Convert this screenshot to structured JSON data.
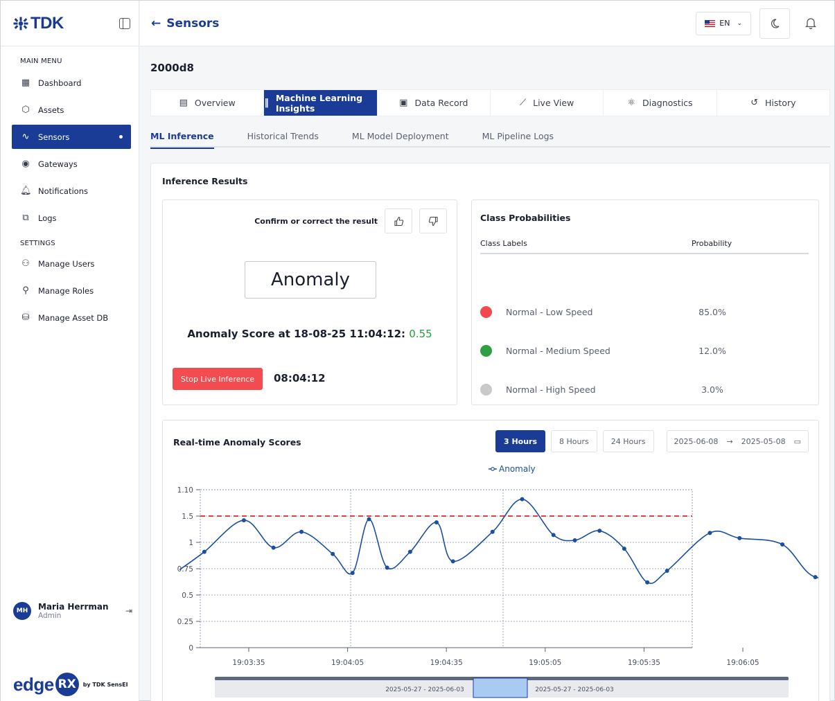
{
  "sidebar": {
    "brand": "TDK",
    "main_menu_heading": "MAIN MENU",
    "settings_heading": "SETTINGS",
    "main_items": [
      {
        "label": "Dashboard",
        "icon": "grid-icon"
      },
      {
        "label": "Assets",
        "icon": "cube-icon"
      },
      {
        "label": "Sensors",
        "icon": "pulse-icon",
        "active": true
      },
      {
        "label": "Gateways",
        "icon": "broadcast-icon"
      },
      {
        "label": "Notifications",
        "icon": "bell-icon"
      },
      {
        "label": "Logs",
        "icon": "copy-icon"
      }
    ],
    "settings_items": [
      {
        "label": "Manage Users",
        "icon": "users-icon"
      },
      {
        "label": "Manage Roles",
        "icon": "user-role-icon"
      },
      {
        "label": "Manage Asset DB",
        "icon": "database-icon"
      }
    ],
    "user": {
      "initials": "MH",
      "name": "Maria Herrman",
      "role": "Admin"
    },
    "footer": {
      "edge": "edge",
      "rx": "RX",
      "by": "by TDK SensEI"
    }
  },
  "header": {
    "back_label": "Sensors",
    "language": "EN"
  },
  "device": {
    "id": "2000d8"
  },
  "tabs": [
    {
      "label": "Overview",
      "icon": "document-icon"
    },
    {
      "label": "Machine Learning Insights",
      "icon": "bars-icon",
      "active": true
    },
    {
      "label": "Data Record",
      "icon": "file-check-icon"
    },
    {
      "label": "Live View",
      "icon": "chart-line-icon"
    },
    {
      "label": "Diagnostics",
      "icon": "atom-icon"
    },
    {
      "label": "History",
      "icon": "history-icon"
    }
  ],
  "subtabs": [
    {
      "label": "ML Inference",
      "active": true
    },
    {
      "label": "Historical Trends"
    },
    {
      "label": "ML Model Deployment"
    },
    {
      "label": "ML Pipeline Logs"
    }
  ],
  "inference": {
    "panel_title": "Inference Results",
    "confirm_label": "Confirm or correct the result",
    "result": "Anomaly",
    "score_prefix": "Anomaly Score at 18-08-25 11:04:12:",
    "score_value": "0.55",
    "stop_button": "Stop Live Inference",
    "timer": "08:04:12"
  },
  "probabilities": {
    "title": "Class Probabilities",
    "col_labels": "Class Labels",
    "col_prob": "Probability",
    "rows": [
      {
        "label": "Normal - Low Speed",
        "value": "85.0%",
        "color": "#f04a4f"
      },
      {
        "label": "Normal - Medium Speed",
        "value": "12.0%",
        "color": "#2ea043"
      },
      {
        "label": "Normal - High Speed",
        "value": "3.0%",
        "color": "#c9c9c9"
      }
    ]
  },
  "scores_chart": {
    "title": "Real-time Anomaly Scores",
    "ranges": [
      {
        "label": "3 Hours",
        "active": true
      },
      {
        "label": "8 Hours"
      },
      {
        "label": "24 Hours"
      }
    ],
    "date_from": "2025-06-08",
    "date_arrow": "→",
    "date_to": "2025-05-08",
    "brush_left_label": "2025-05-27 - 2025-06-03",
    "brush_right_label": "2025-05-27 - 2025-06-03"
  },
  "chart_data": {
    "type": "line",
    "title": "Real-time Anomaly Scores",
    "legend": [
      "Anomaly"
    ],
    "legend_position": "top-center",
    "xlabel": "",
    "ylabel": "",
    "x_ticks": [
      "19:03:35",
      "19:04:05",
      "19:04:35",
      "19:05:05",
      "19:05:35",
      "19:06:05"
    ],
    "y_ticks": [
      "0",
      "0.25",
      "0.5",
      "0.75",
      "1",
      "1.5",
      "1.10"
    ],
    "threshold": 1.5,
    "series": [
      {
        "name": "Anomaly",
        "color": "#1b4fa0",
        "x": [
          -21,
          -13.5,
          -1.5,
          7.5,
          16,
          25.5,
          31.5,
          36.5,
          42,
          49,
          57,
          62,
          74,
          83,
          92.5,
          99,
          106.5,
          114,
          121,
          127,
          140,
          149,
          162,
          172,
          186,
          198
        ],
        "y": [
          0.74,
          0.91,
          1.21,
          0.95,
          1.1,
          0.89,
          0.71,
          1.22,
          0.76,
          0.91,
          1.19,
          0.82,
          1.1,
          1.41,
          1.07,
          1.02,
          1.11,
          0.94,
          0.62,
          0.73,
          1.09,
          1.04,
          0.98,
          0.67,
          0.74,
          0.89
        ]
      }
    ]
  }
}
